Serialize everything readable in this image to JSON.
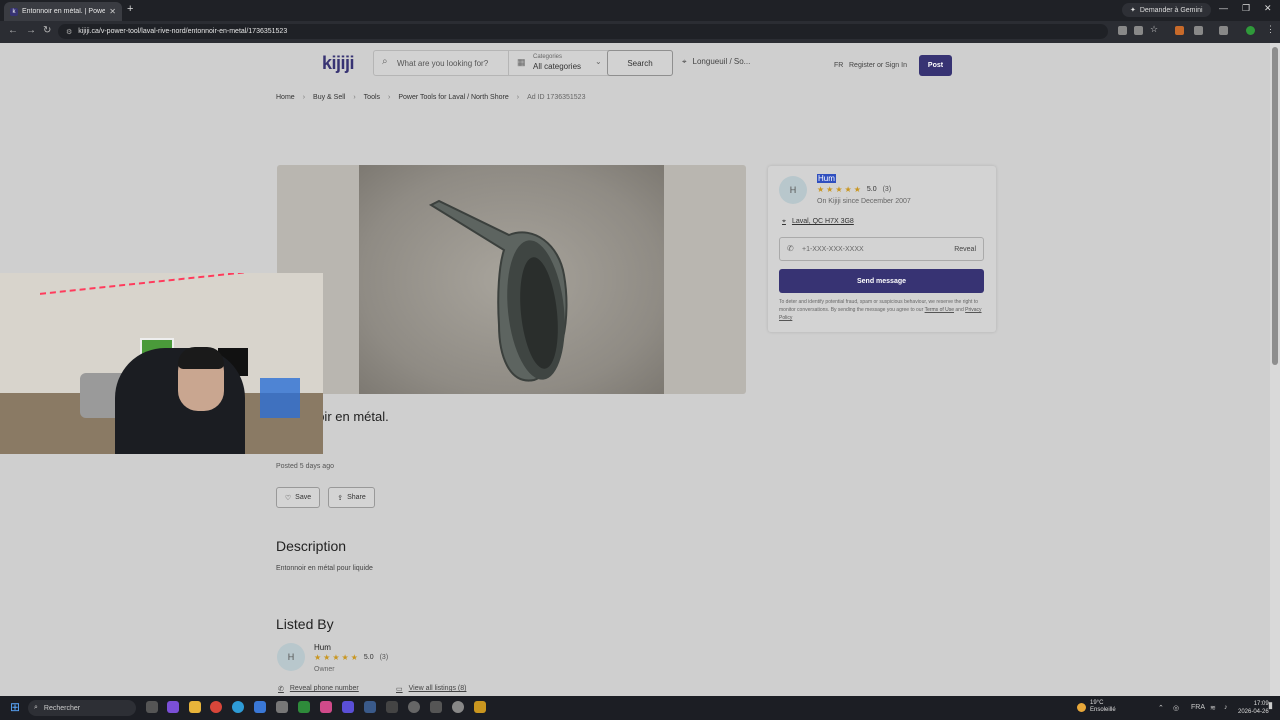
{
  "browser": {
    "tab_title": "Entonnoir en métal. | Power To",
    "tab_favicon": "k",
    "url": "kijiji.ca/v-power-tool/laval-rive-nord/entonnoir-en-metal/1736351523",
    "gemini_label": "Demander à Gemini"
  },
  "header": {
    "logo": "kijiji",
    "search_placeholder": "What are you looking for?",
    "categories_label": "Categories",
    "categories_value": "All categories",
    "search_button": "Search",
    "location": "Longueuil / So...",
    "lang": "FR",
    "register_signin": "Register or Sign In",
    "post_button": "Post"
  },
  "breadcrumb": {
    "items": [
      "Home",
      "Buy & Sell",
      "Tools",
      "Power Tools for Laval / North Shore"
    ],
    "ad_id": "Ad ID 1736351523"
  },
  "listing": {
    "title": "Entonnoir en métal.",
    "posted": "Posted 5 days ago",
    "save_label": "Save",
    "share_label": "Share",
    "description_heading": "Description",
    "description_text": "Entonnoir en métal pour liquide",
    "listed_by_heading": "Listed By"
  },
  "seller": {
    "initial": "H",
    "name": "Hum",
    "rating": "5.0",
    "rating_count": "(3)",
    "stars": 5,
    "since": "On Kijiji since December 2007",
    "address": "Laval, QC H7X 3G8",
    "phone_masked": "+1-XXX-XXX-XXXX",
    "reveal_label": "Reveal",
    "send_message": "Send message",
    "fine_print_1": "To deter and identify potential fraud, spam or suspicious behaviour, we reserve the right to monitor conversations. By sending the message you agree to our",
    "terms_link": "Terms of Use",
    "and_text": "and",
    "privacy_link": "Privacy Policy",
    "role": "Owner",
    "reveal_phone_link": "Reveal phone number",
    "view_listings_link": "View all listings (8)"
  },
  "taskbar": {
    "search_placeholder": "Rechercher",
    "weather_temp": "19°C",
    "weather_text": "Ensoleillé",
    "lang": "FRA",
    "time": "17:09",
    "date": "2026-04-26"
  },
  "colors": {
    "brand": "#373373",
    "star": "#c9961f",
    "selection": "#2f4fbf"
  }
}
